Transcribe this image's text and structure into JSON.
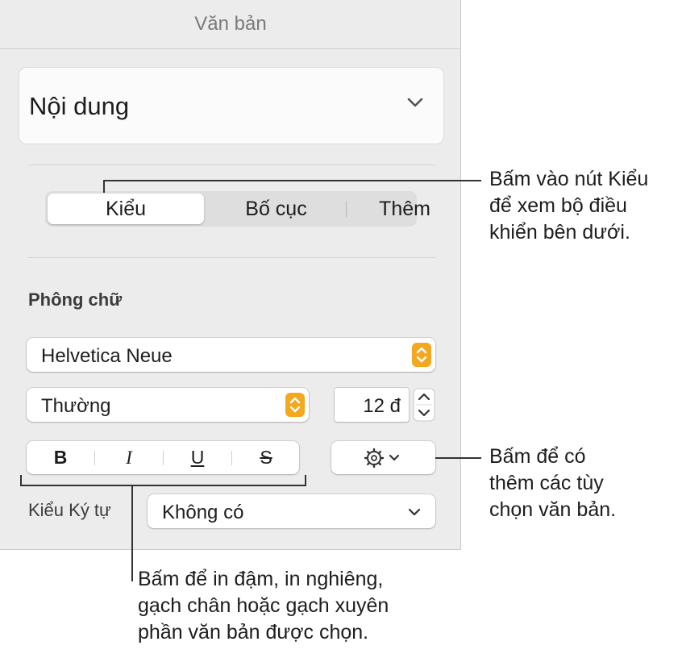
{
  "panel": {
    "title": "Văn bản"
  },
  "paragraph_style": {
    "value": "Nội dung"
  },
  "tabs": [
    {
      "label": "Kiểu",
      "active": true
    },
    {
      "label": "Bố cục",
      "active": false
    },
    {
      "label": "Thêm",
      "active": false
    }
  ],
  "font": {
    "section_label": "Phông chữ",
    "family": "Helvetica Neue",
    "typeface": "Thường",
    "size": "12 đ"
  },
  "format_buttons": {
    "bold": "B",
    "italic": "I",
    "underline": "U",
    "strike": "S"
  },
  "char_style": {
    "label": "Kiểu Ký tự",
    "value": "Không có"
  },
  "callouts": {
    "tabs": [
      "Bấm vào nút Kiểu",
      "để xem bộ điều",
      "khiển bên dưới."
    ],
    "more": [
      "Bấm để có",
      "thêm các tùy",
      "chọn văn bản."
    ],
    "format": [
      "Bấm để in đậm, in nghiêng,",
      "gạch chân hoặc gạch xuyên",
      "phần văn bản được chọn."
    ]
  },
  "colors": {
    "accent": "#f4a820",
    "panel_bg": "#ececec"
  }
}
